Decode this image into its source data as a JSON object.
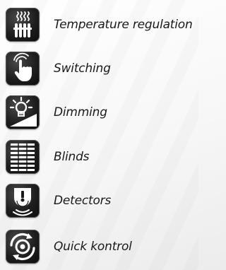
{
  "features": [
    {
      "label": "Temperature regulation",
      "icon": "heater-icon"
    },
    {
      "label": "Switching",
      "icon": "hand-switch-icon"
    },
    {
      "label": "Dimming",
      "icon": "lightbulb-dimmer-icon"
    },
    {
      "label": "Blinds",
      "icon": "window-blinds-icon"
    },
    {
      "label": "Detectors",
      "icon": "motion-detector-icon"
    },
    {
      "label": "Quick kontrol",
      "icon": "quick-control-icon"
    }
  ]
}
